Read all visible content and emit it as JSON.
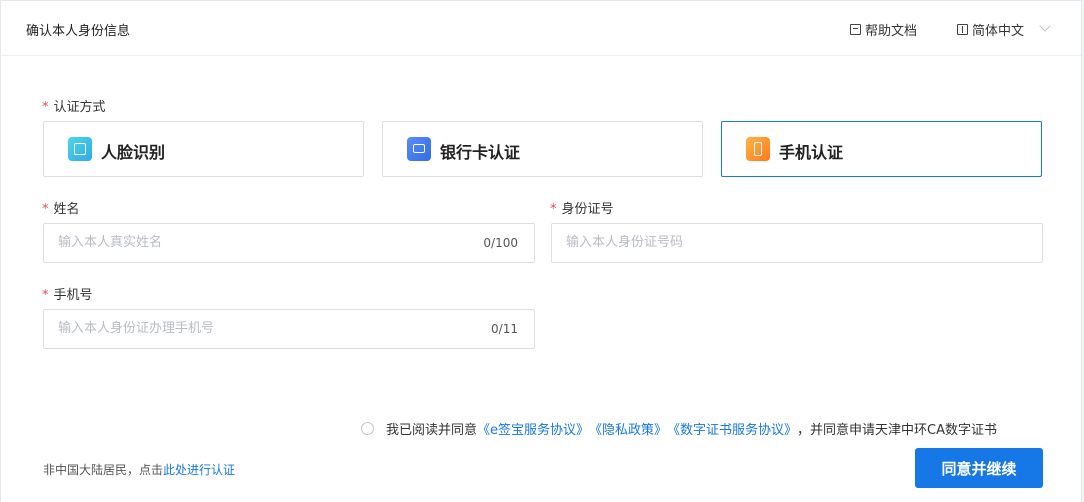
{
  "header": {
    "title": "确认本人身份信息",
    "help_label": "帮助文档",
    "lang_label": "简体中文"
  },
  "auth": {
    "required_mark": "*",
    "label": "认证方式",
    "options": [
      {
        "label": "人脸识别",
        "icon": "face-scan-icon",
        "selected": false
      },
      {
        "label": "银行卡认证",
        "icon": "bank-card-icon",
        "selected": false
      },
      {
        "label": "手机认证",
        "icon": "phone-icon",
        "selected": true
      }
    ]
  },
  "fields": {
    "name": {
      "label": "姓名",
      "placeholder": "输入本人真实姓名",
      "counter": "0/100"
    },
    "id": {
      "label": "身份证号",
      "placeholder": "输入本人身份证号码"
    },
    "phone": {
      "label": "手机号",
      "placeholder": "输入本人身份证办理手机号",
      "counter": "0/11"
    }
  },
  "agreement": {
    "prefix": "我已阅读并同意",
    "link1": "《e签宝服务协议》",
    "link2": "《隐私政策》",
    "link3": "《数字证书服务协议》",
    "suffix": "，并同意申请天津中环CA数字证书"
  },
  "footer": {
    "text": "非中国大陆居民，点击",
    "link": "此处进行认证"
  },
  "submit_label": "同意并继续",
  "colors": {
    "primary": "#1677e6",
    "required": "#e34d59"
  }
}
